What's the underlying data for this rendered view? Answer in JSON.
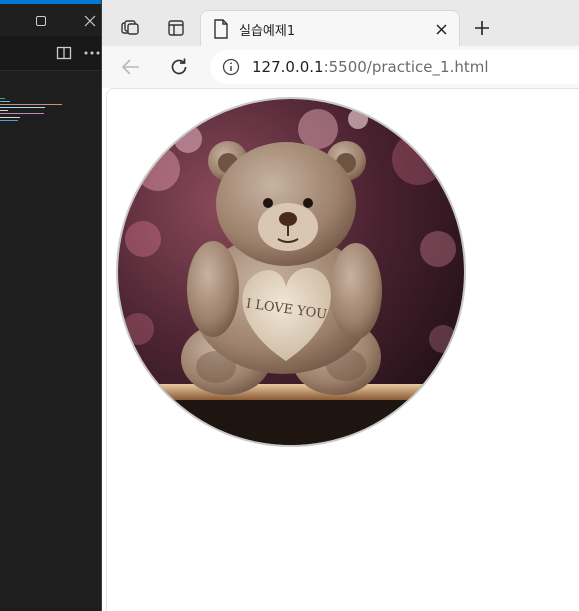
{
  "editor": {
    "window_controls": [
      "restore-icon",
      "close-icon"
    ],
    "toolbar_icons": [
      "split-editor-icon",
      "more-icon"
    ]
  },
  "browser": {
    "tab": {
      "title": "실습예제1",
      "icon": "page-icon"
    },
    "address": {
      "host": "127.0.0.1",
      "rest": ":5500/practice_1.html"
    },
    "page": {
      "image_alt": "I LOVE YOU",
      "image_text": "I LOVE YOU"
    }
  },
  "colors": {
    "editor_bg": "#1e1e1e",
    "accent": "#0078d4",
    "tabstrip_bg": "#e9e9e9",
    "toolbar_bg": "#f7f7f7"
  }
}
